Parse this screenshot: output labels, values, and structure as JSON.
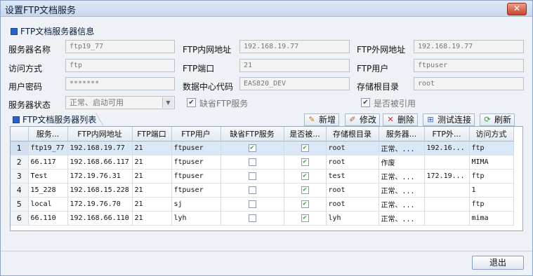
{
  "window": {
    "title": "设置FTP文档服务",
    "close_label": "✕"
  },
  "info_section": {
    "title": "FTP文档服务器信息"
  },
  "form": {
    "server_name": {
      "label": "服务器名称",
      "value": "ftp19_77"
    },
    "inner_ip": {
      "label": "FTP内网地址",
      "value": "192.168.19.77"
    },
    "outer_ip": {
      "label": "FTP外网地址",
      "value": "192.168.19.77"
    },
    "access_mode": {
      "label": "访问方式",
      "value": "ftp"
    },
    "port": {
      "label": "FTP端口",
      "value": "21"
    },
    "ftp_user": {
      "label": "FTP用户",
      "value": "ftpuser"
    },
    "password": {
      "label": "用户密码",
      "value": "*******"
    },
    "dc_code": {
      "label": "数据中心代码",
      "value": "EAS820_DEV"
    },
    "root_dir": {
      "label": "存储根目录",
      "value": "root"
    },
    "status": {
      "label": "服务器状态",
      "value": "正常、启动可用",
      "arrow": "▼"
    },
    "default_ftp": {
      "label": "缺省FTP服务",
      "checked": true,
      "mark": "✔"
    },
    "referenced": {
      "label": "是否被引用",
      "checked": true,
      "mark": "✔"
    }
  },
  "list_section": {
    "title": "FTP文档服务器列表"
  },
  "toolbar": {
    "add": {
      "label": "新增",
      "icon": "add-icon"
    },
    "edit": {
      "label": "修改",
      "icon": "edit-icon"
    },
    "delete": {
      "label": "删除",
      "icon": "delete-icon"
    },
    "test": {
      "label": "测试连接",
      "icon": "network-icon"
    },
    "refresh": {
      "label": "刷新",
      "icon": "refresh-icon"
    }
  },
  "table": {
    "columns": [
      "",
      "服务...",
      "FTP内网地址",
      "FTP端口",
      "FTP用户",
      "缺省FTP服务",
      "是否被...",
      "存储根目录",
      "服务器...",
      "FTP外...",
      "访问方式"
    ],
    "check_mark": "✔",
    "rows": [
      {
        "idx": "1",
        "name": "ftp19_77",
        "inner": "192.168.19.77",
        "port": "21",
        "user": "ftpuser",
        "default": true,
        "ref": true,
        "root": "root",
        "status": "正常、...",
        "outer": "192.16...",
        "access": "ftp",
        "selected": true
      },
      {
        "idx": "2",
        "name": "66.117",
        "inner": "192.168.66.117",
        "port": "21",
        "user": "ftpuser",
        "default": false,
        "ref": true,
        "root": "root",
        "status": "作废",
        "outer": "",
        "access": "MIMA",
        "selected": false
      },
      {
        "idx": "3",
        "name": "Test",
        "inner": "172.19.76.31",
        "port": "21",
        "user": "ftpuser",
        "default": false,
        "ref": true,
        "root": "test",
        "status": "正常、...",
        "outer": "172.19...",
        "access": "ftp",
        "selected": false
      },
      {
        "idx": "4",
        "name": "15_228",
        "inner": "192.168.15.228",
        "port": "21",
        "user": "ftpuser",
        "default": false,
        "ref": true,
        "root": "root",
        "status": "正常、...",
        "outer": "",
        "access": "1",
        "selected": false
      },
      {
        "idx": "5",
        "name": "local",
        "inner": "172.19.76.70",
        "port": "21",
        "user": "sj",
        "default": false,
        "ref": true,
        "root": "root",
        "status": "正常、...",
        "outer": "",
        "access": "ftp",
        "selected": false
      },
      {
        "idx": "6",
        "name": "66.110",
        "inner": "192.168.66.110",
        "port": "21",
        "user": "lyh",
        "default": false,
        "ref": true,
        "root": "lyh",
        "status": "正常、...",
        "outer": "",
        "access": "mima",
        "selected": false
      }
    ]
  },
  "footer": {
    "exit_label": "退出"
  },
  "colors": {
    "accent": "#2a62c9",
    "check_green": "#2e9a2e",
    "selected_row": "#dae7f7"
  }
}
